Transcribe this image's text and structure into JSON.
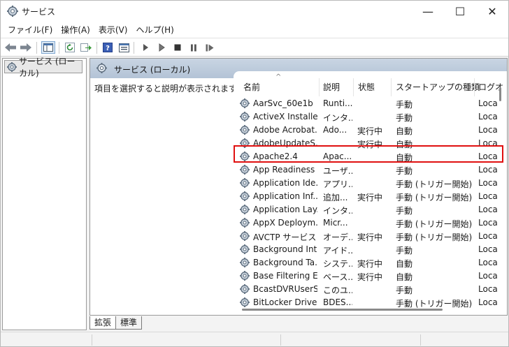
{
  "window": {
    "title": "サービス",
    "minimize_glyph": "—",
    "maximize_glyph": "☐",
    "close_glyph": "✕"
  },
  "menu": [
    "ファイル(F)",
    "操作(A)",
    "表示(V)",
    "ヘルプ(H)"
  ],
  "toolbar": {
    "icons": [
      "back-arrow-icon",
      "forward-arrow-icon",
      "console-tree-icon",
      "refresh-icon",
      "export-list-icon",
      "help-icon",
      "properties-icon",
      "play-icon",
      "play-outline-icon",
      "stop-icon",
      "pause-icon",
      "resume-icon"
    ]
  },
  "tree": {
    "root_label": "サービス (ローカル)"
  },
  "pane": {
    "title": "サービス (ローカル)",
    "description": "項目を選択すると説明が表示されます。"
  },
  "columns": [
    "名前",
    "説明",
    "状態",
    "スタートアップの種類",
    "ログオ"
  ],
  "sort_indicator": "^",
  "rows": [
    {
      "name": "AarSvc_60e1b",
      "desc": "Runti...",
      "state": "",
      "start": "手動",
      "logon": "Loca"
    },
    {
      "name": "ActiveX Installe...",
      "desc": "インタ...",
      "state": "",
      "start": "手動",
      "logon": "Loca"
    },
    {
      "name": "Adobe Acrobat...",
      "desc": "Ado...",
      "state": "実行中",
      "start": "自動",
      "logon": "Loca"
    },
    {
      "name": "AdobeUpdateS...",
      "desc": "",
      "state": "実行中",
      "start": "自動",
      "logon": "Loca"
    },
    {
      "name": "Apache2.4",
      "desc": "Apac...",
      "state": "",
      "start": "自動",
      "logon": "Loca"
    },
    {
      "name": "App Readiness",
      "desc": "ユーザ...",
      "state": "",
      "start": "手動",
      "logon": "Loca"
    },
    {
      "name": "Application Ide...",
      "desc": "アプリ...",
      "state": "",
      "start": "手動 (トリガー開始)",
      "logon": "Loca"
    },
    {
      "name": "Application Inf...",
      "desc": "追加...",
      "state": "実行中",
      "start": "手動 (トリガー開始)",
      "logon": "Loca"
    },
    {
      "name": "Application Lay...",
      "desc": "インタ...",
      "state": "",
      "start": "手動",
      "logon": "Loca"
    },
    {
      "name": "AppX Deploym...",
      "desc": "Micr...",
      "state": "",
      "start": "手動 (トリガー開始)",
      "logon": "Loca"
    },
    {
      "name": "AVCTP サービス",
      "desc": "オーデ...",
      "state": "実行中",
      "start": "手動 (トリガー開始)",
      "logon": "Loca"
    },
    {
      "name": "Background Int...",
      "desc": "アイド...",
      "state": "",
      "start": "手動",
      "logon": "Loca"
    },
    {
      "name": "Background Ta...",
      "desc": "システ...",
      "state": "実行中",
      "start": "自動",
      "logon": "Loca"
    },
    {
      "name": "Base Filtering E...",
      "desc": "ベース...",
      "state": "実行中",
      "start": "自動",
      "logon": "Loca"
    },
    {
      "name": "BcastDVRUserS...",
      "desc": "このユ...",
      "state": "",
      "start": "手動",
      "logon": "Loca"
    },
    {
      "name": "BitLocker Drive ...",
      "desc": "BDES...",
      "state": "",
      "start": "手動 (トリガー開始)",
      "logon": "Loca"
    }
  ],
  "highlight_color": "#e01010",
  "tabs": [
    "拡張",
    "標準"
  ]
}
